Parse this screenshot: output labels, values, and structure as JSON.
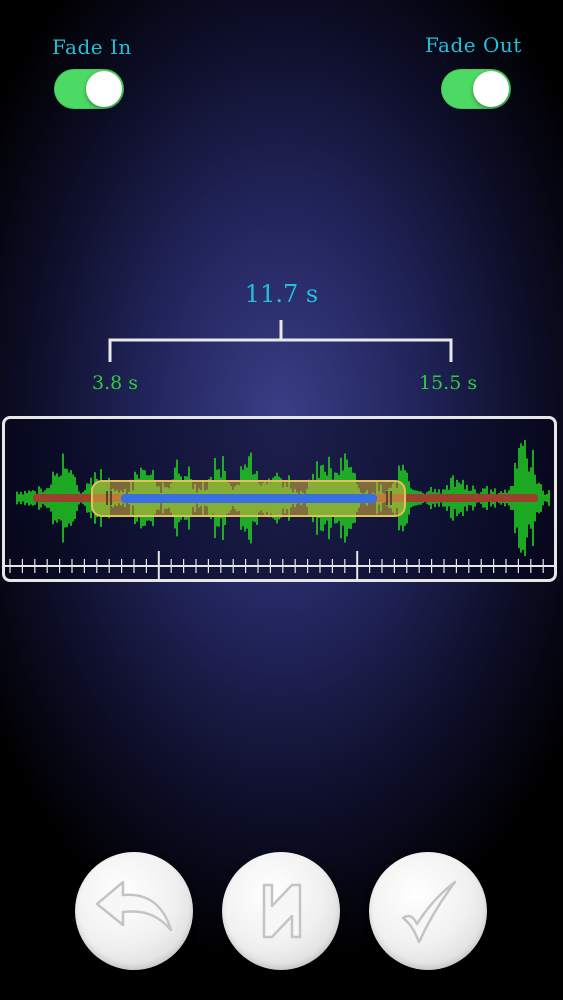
{
  "fade_in": {
    "label": "Fade In",
    "enabled": true
  },
  "fade_out": {
    "label": "Fade Out",
    "enabled": true
  },
  "selection": {
    "duration": "11.7 s",
    "start": "3.8 s",
    "end": "15.5 s"
  },
  "colors": {
    "accent_cyan": "#22c0d8",
    "time_green": "#2ecc40",
    "waveform_green": "#22d022",
    "toggle_on": "#4cd964",
    "selection_blue": "#3a6fe0",
    "track_red": "#b03030",
    "handle_gold": "#d8b040"
  },
  "controls": [
    {
      "name": "back",
      "icon": "undo-arrow-icon"
    },
    {
      "name": "play",
      "icon": "play-icon"
    },
    {
      "name": "confirm",
      "icon": "checkmark-icon"
    }
  ]
}
